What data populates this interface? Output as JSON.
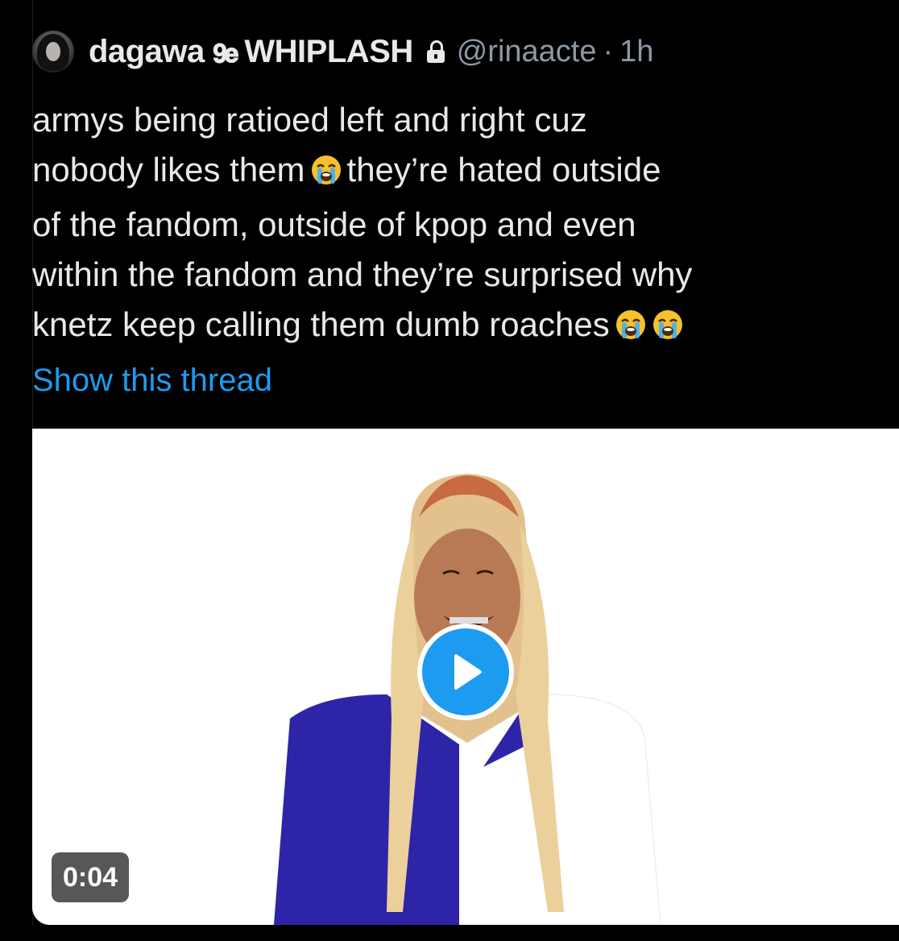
{
  "tweet": {
    "display_name": "dagawa 💓 WHIPLASH",
    "handle": "@rinaacte",
    "separator": "·",
    "time": "1h",
    "lock_icon": "lock-icon",
    "text_lines": [
      "armys being ratioed left and right cuz",
      "nobody likes them",
      "they’re hated outside",
      "of the fandom, outside of kpop and even",
      "within the fandom and they’re surprised why",
      "knetz keep calling them dumb roaches"
    ],
    "emoji_icon": "loudly-crying-face-icon",
    "show_thread": "Show this thread"
  },
  "media": {
    "type": "video",
    "duration": "0:04",
    "play_icon": "play-icon"
  },
  "colors": {
    "background": "#000000",
    "text": "#e7e9ea",
    "secondary": "#8b98a5",
    "link": "#1d9bf0",
    "play_button": "#1d9bf0"
  }
}
